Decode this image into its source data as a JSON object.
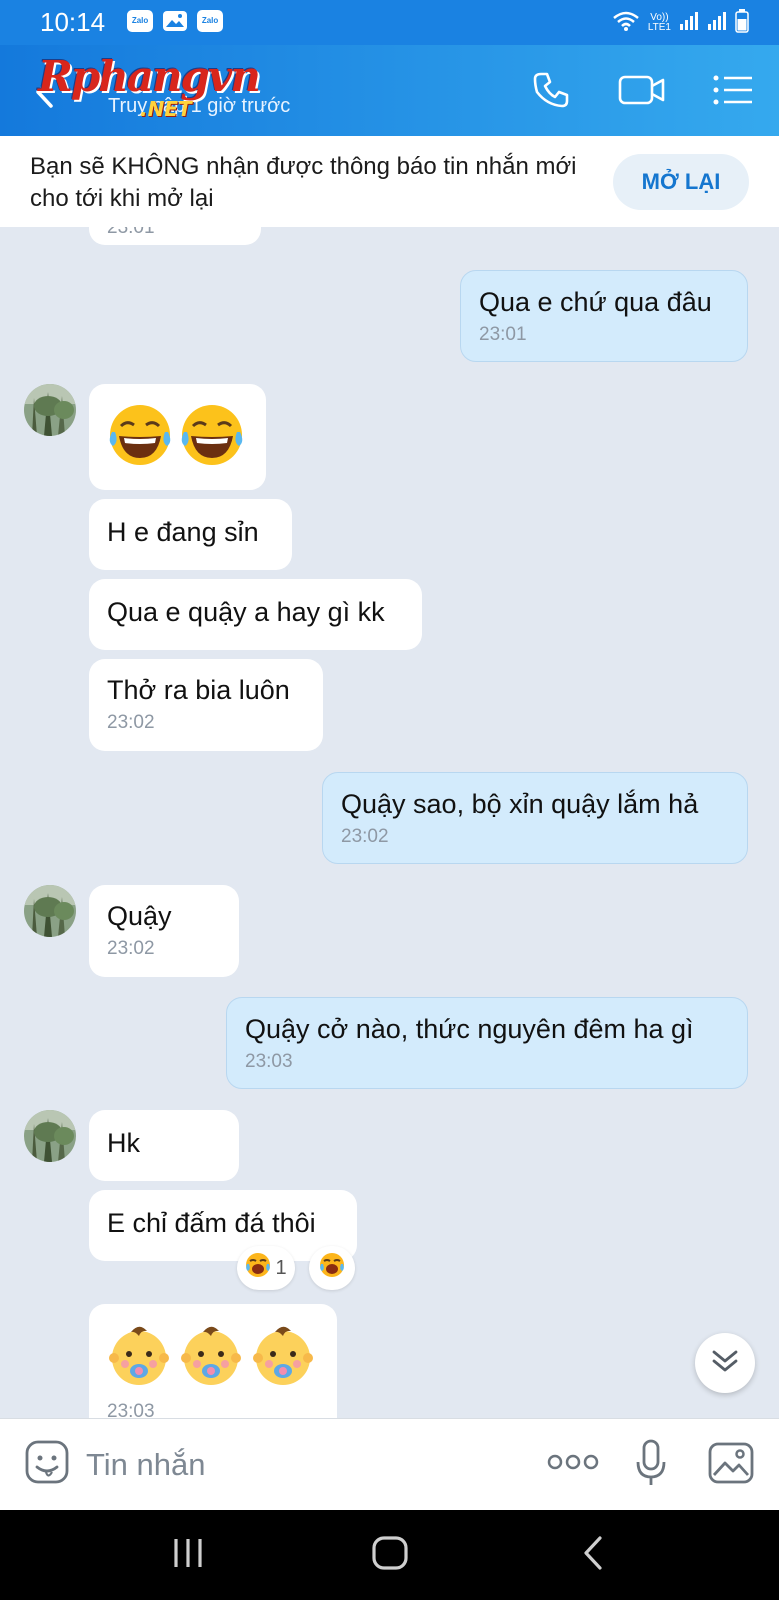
{
  "status_bar": {
    "time": "10:14",
    "notifications": [
      "Zalo",
      "Zalo"
    ],
    "network_label_1": "Vo))",
    "network_label_2": "LTE1"
  },
  "header": {
    "watermark": "Rphangvn",
    "watermark_net": ".NET",
    "last_seen": "Truy cập 1 giờ trước"
  },
  "notice": {
    "text": "Bạn sẽ KHÔNG nhận được thông báo tin nhắn mới cho tới khi mở lại",
    "button_label": "MỞ LẠI"
  },
  "messages": [
    {
      "dir": "in",
      "time": "23:01"
    },
    {
      "dir": "out",
      "text": "Qua e chứ qua đâu",
      "time": "23:01"
    },
    {
      "dir": "in",
      "emoji": "laughing-tears",
      "emoji_count": 2
    },
    {
      "dir": "in",
      "text": "H e đang sỉn"
    },
    {
      "dir": "in",
      "text": "Qua e quậy a hay gì kk"
    },
    {
      "dir": "in",
      "text": "Thở ra bia luôn",
      "time": "23:02"
    },
    {
      "dir": "out",
      "text": "Quậy sao, bộ xỉn quậy lắm hả",
      "time": "23:02"
    },
    {
      "dir": "in",
      "text": "Quậy",
      "time": "23:02"
    },
    {
      "dir": "out",
      "text": "Quậy cở nào, thức nguyên đêm ha gì",
      "time": "23:03"
    },
    {
      "dir": "in",
      "text": "Hk"
    },
    {
      "dir": "in",
      "text": "E chỉ đấm đá thôi",
      "reaction_count": "1"
    },
    {
      "dir": "in",
      "emoji": "baby-pacifier",
      "emoji_count": 3,
      "time": "23:03"
    }
  ],
  "input": {
    "placeholder": "Tin nhắn"
  },
  "colors": {
    "header": "#1a82e2",
    "outgoing_bubble": "#d3ebfc",
    "incoming_bubble": "#ffffff",
    "chat_background": "#e2e8f1",
    "accent": "#1576cf"
  }
}
